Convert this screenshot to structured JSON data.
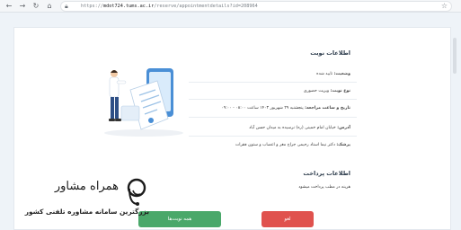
{
  "browser": {
    "url_prefix": "https://",
    "url_host": "mdot724.tums.ac.ir",
    "url_path": "/reserve/appointmentdetails?id=208964"
  },
  "appointment": {
    "title": "اطلاعات نوبت",
    "status_key": "وضعیت:",
    "status_value": "تایید شده",
    "type_key": "نوع نوبت:",
    "type_value": "ویزیت حضوری",
    "datetime_key": "تاریخ و ساعت مراجعه:",
    "datetime_value": "پنجشنبه ۲۹ شهریور ۱۴۰۳ ساعت ۰۸:۰۰ - ۰۹:۰۰",
    "address_key": "آدرس:",
    "address_value": "خیابان امام خمینی (ره) نرسیده به میدان حسن آباد",
    "doctor_key": "پزشک:",
    "doctor_value": "دکتر نیما استاد رحیمی جراح مغز و اعصاب و ستون فقرات"
  },
  "payment": {
    "title": "اطلاعات پرداخت",
    "note": "هزینه در مطب پرداخت میشود"
  },
  "actions": {
    "primary_label": "همه نوبت‌ها",
    "cancel_label": "لغو"
  },
  "watermark": {
    "title": "همراه مشاور",
    "subtitle": "بزرگترین سامانه مشاوره تلفنی کشور"
  },
  "colors": {
    "primary_button": "#4aa86a",
    "cancel_button": "#e0524e",
    "illustration_accent": "#4a8fd6"
  }
}
